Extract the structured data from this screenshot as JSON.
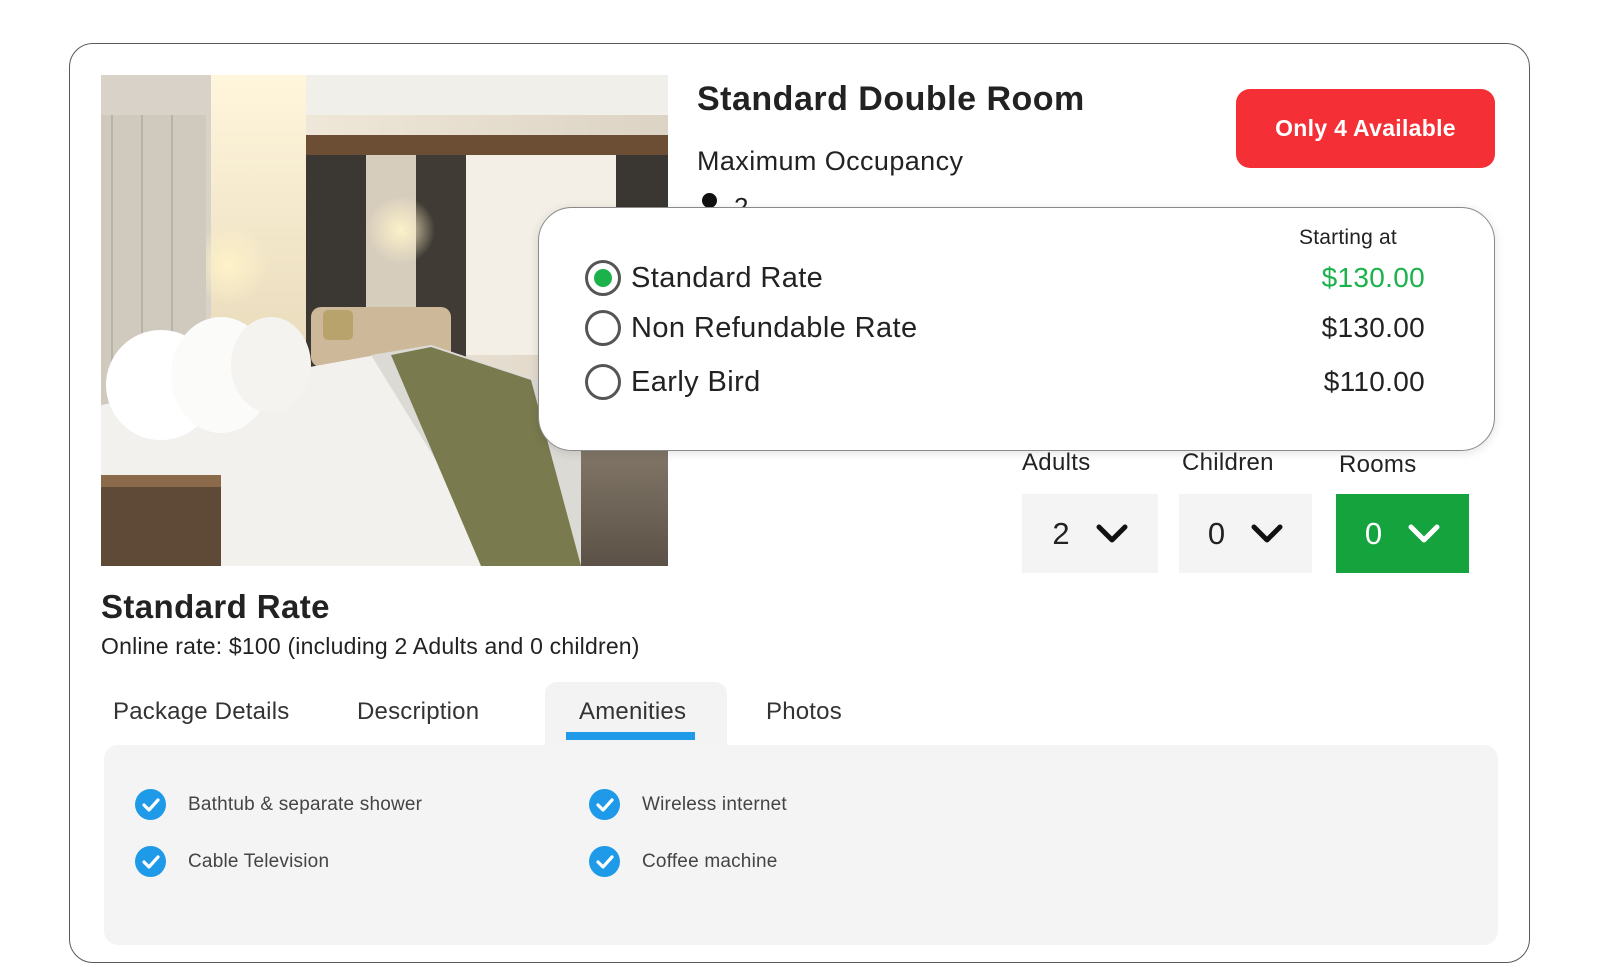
{
  "room": {
    "title": "Standard Double Room",
    "occupancy_label": "Maximum Occupancy",
    "occupancy_value": "2",
    "availability": "Only 4 Available"
  },
  "rates": {
    "starting_label": "Starting at",
    "options": [
      {
        "name": "Standard Rate",
        "price": "$130.00",
        "selected": true
      },
      {
        "name": "Non Refundable Rate",
        "price": "$130.00",
        "selected": false
      },
      {
        "name": "Early Bird",
        "price": "$110.00",
        "selected": false
      }
    ]
  },
  "selectors": {
    "adults": {
      "label": "Adults",
      "value": "2"
    },
    "children": {
      "label": "Children",
      "value": "0"
    },
    "rooms": {
      "label": "Rooms",
      "value": "0"
    }
  },
  "selected_rate": {
    "heading": "Standard Rate",
    "online_rate": "Online rate: $100 (including 2 Adults and 0 children)"
  },
  "tabs": [
    {
      "label": "Package Details",
      "active": false
    },
    {
      "label": "Description",
      "active": false
    },
    {
      "label": "Amenities",
      "active": true
    },
    {
      "label": "Photos",
      "active": false
    }
  ],
  "amenities": [
    "Bathtub & separate shower",
    "Wireless internet",
    "Cable Television",
    "Coffee machine"
  ],
  "colors": {
    "availability_red": "#f42f36",
    "price_green": "#1cb24b",
    "rooms_green": "#15a33d",
    "accent_blue": "#1e9ae8"
  },
  "icons": {
    "radio_selected": "radio-selected-icon",
    "radio_unselected": "radio-unselected-icon",
    "dropdown": "chevron-down-icon",
    "amenity_check": "check-circle-icon"
  }
}
